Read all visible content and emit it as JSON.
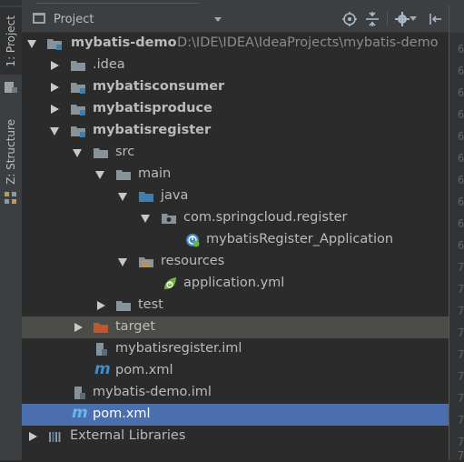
{
  "side_tabs": {
    "project": "1: Project",
    "structure": "Z: Structure"
  },
  "header": {
    "title": "Project"
  },
  "gutter_numbers": [
    "6",
    "6",
    "6",
    "6",
    "6",
    "6",
    "6",
    "6",
    "6",
    "6",
    "7",
    "7",
    "7",
    "7",
    "7",
    "7",
    "7",
    "7",
    "7",
    "7",
    "8"
  ],
  "tree": [
    {
      "label": "mybatis-demo",
      "path": "D:\\IDE\\IDEA\\IdeaProjects\\mybatis-demo"
    },
    {
      "label": ".idea"
    },
    {
      "label": "mybatisconsumer"
    },
    {
      "label": "mybatisproduce"
    },
    {
      "label": "mybatisregister"
    },
    {
      "label": "src"
    },
    {
      "label": "main"
    },
    {
      "label": "java"
    },
    {
      "label": "com.springcloud.register"
    },
    {
      "label": "mybatisRegister_Application"
    },
    {
      "label": "resources"
    },
    {
      "label": "application.yml"
    },
    {
      "label": "test"
    },
    {
      "label": "target"
    },
    {
      "label": "mybatisregister.iml"
    },
    {
      "label": "pom.xml"
    },
    {
      "label": "mybatis-demo.iml"
    },
    {
      "label": "pom.xml"
    },
    {
      "label": "External Libraries"
    }
  ],
  "colors": {
    "background": "#2b2b2b",
    "panel": "#3c3f41",
    "selection": "#4b6eaf",
    "folder": "#87939a",
    "source_folder": "#3f7fb0",
    "excluded_folder": "#c0582e"
  }
}
